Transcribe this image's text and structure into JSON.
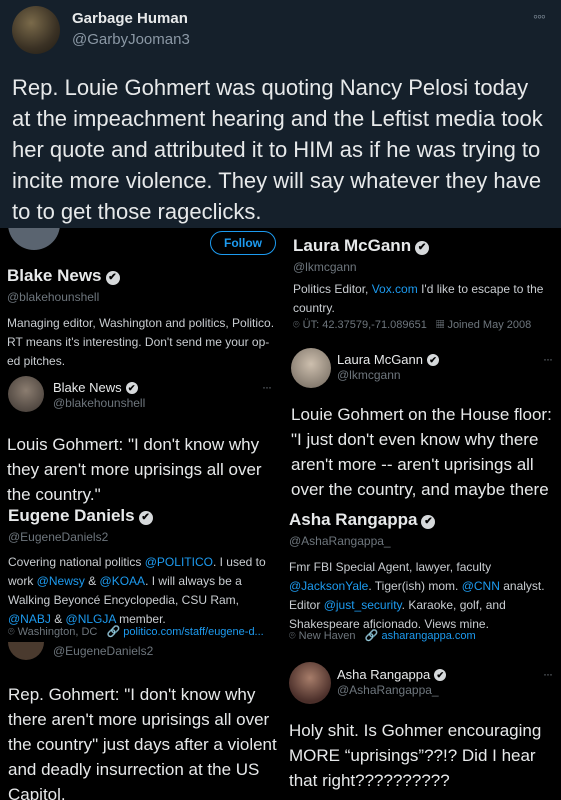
{
  "top_tweet": {
    "name": "Garbage Human",
    "handle": "@GarbyJooman3",
    "more": "◦◦◦",
    "text": "Rep. Louie Gohmert was quoting Nancy Pelosi today at the impeachment hearing and the Leftist media took her quote and attributed it to HIM as if he was trying to incite more violence. They will say whatever they have to to get those rageclicks."
  },
  "blake": {
    "follow_label": "Follow",
    "name": "Blake News",
    "handle": "@blakehounshell",
    "bio": "Managing editor, Washington and politics, Politico. RT means it's interesting. Don't send me your op-ed pitches.",
    "tweet_name": "Blake News",
    "tweet_handle": "@blakehounshell",
    "tweet_text": "Louis Gohmert: \"I don't know why they aren't more uprisings all over the country.\""
  },
  "eugene": {
    "name": "Eugene Daniels",
    "handle": "@EugeneDaniels2",
    "bio_1": "Covering national politics ",
    "bio_politico": "@POLITICO",
    "bio_2": ". I used to work ",
    "bio_newsy": "@Newsy",
    "bio_amp1": " & ",
    "bio_koaa": "@KOAA",
    "bio_3": ". I will always be a Walking Beyoncé Encyclopedia, CSU Ram, ",
    "bio_nabj": "@NABJ",
    "bio_amp2": " & ",
    "bio_nlgja": "@NLGJA",
    "bio_4": " member.",
    "location": "Washington, DC",
    "website": "politico.com/staff/eugene-d...",
    "tweet_handle": "@EugeneDaniels2",
    "tweet_text": "Rep. Gohmert: \"I don't know why there aren't more uprisings all over the country\" just days after a violent and deadly insurrection at the US Capitol."
  },
  "laura": {
    "name": "Laura McGann",
    "handle": "@lkmcgann",
    "bio_1": "Politics Editor, ",
    "bio_link": "Vox.com",
    "bio_2": " I'd like to escape to the country.",
    "location": "ÜT: 42.37579,-71.089651",
    "joined": "Joined May 2008",
    "tweet_name": "Laura McGann",
    "tweet_handle": "@lkmcgann",
    "tweet_text": "Louie Gohmert on the House floor: \"I just don't even know why there aren't more -- aren't uprisings all over the country, and maybe there will be.\""
  },
  "asha": {
    "name": "Asha Rangappa",
    "handle": "@AshaRangappa_",
    "bio_1": "Fmr FBI Special Agent, lawyer, faculty ",
    "bio_yale": "@JacksonYale",
    "bio_2": ". Tiger(ish) mom. ",
    "bio_cnn": "@CNN",
    "bio_3": " analyst. Editor ",
    "bio_js": "@just_security",
    "bio_4": ". Karaoke, golf, and Shakespeare aficionado. Views mine.",
    "location": "New Haven",
    "website": "asharangappa.com",
    "tweet_name": "Asha Rangappa",
    "tweet_handle": "@AshaRangappa_",
    "tweet_text": "Holy shit. Is Gohmer encouraging MORE “uprisings”??!? Did I hear that right??????????"
  },
  "icons": {
    "verified": "✔",
    "location": "⌾",
    "link": "🔗",
    "calendar": "▦",
    "more": "···"
  },
  "colors": {
    "top_background": "#15202b",
    "panel_background": "#000000",
    "link": "#1d9bf0",
    "muted": "#6e767d"
  }
}
